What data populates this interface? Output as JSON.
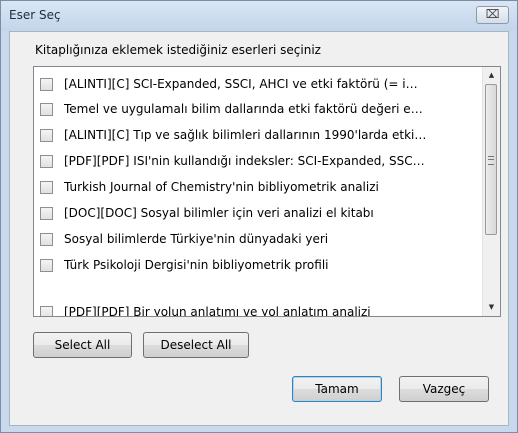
{
  "window": {
    "title": "Eser Seç",
    "close_label": "⌧"
  },
  "prompt": "Kitaplığınıza eklemek istediğiniz eserleri seçiniz",
  "items": [
    {
      "label": "[ALINTI][C] SCI-Expanded, SSCI, AHCI ve etki faktörü (= i…",
      "checked": false
    },
    {
      "label": "Temel ve uygulamalı bilim dallarında etki faktörü değeri e…",
      "checked": false
    },
    {
      "label": "[ALINTI][C] Tıp ve sağlık bilimleri dallarının 1990'larda etki…",
      "checked": false
    },
    {
      "label": "[PDF][PDF] ISI'nin kullandığı indeksler: SCI-Expanded, SSC…",
      "checked": false
    },
    {
      "label": "Turkish Journal of Chemistry'nin bibliyometrik analizi",
      "checked": false
    },
    {
      "label": "[DOC][DOC] Sosyal bilimler için veri analizi el kitabı",
      "checked": false
    },
    {
      "label": "Sosyal bilimlerde Türkiye'nin dünyadaki yeri",
      "checked": false
    },
    {
      "label": "Türk Psikoloji Dergisi'nin bibliyometrik profili",
      "checked": false
    },
    {
      "label": "[PDF][PDF] Bir yolun anlatımı ve yol anlatım analizi",
      "checked": false
    }
  ],
  "scrollbar": {
    "up_glyph": "▲",
    "down_glyph": "▼"
  },
  "buttons": {
    "select_all": "Select All",
    "deselect_all": "Deselect All",
    "ok": "Tamam",
    "cancel": "Vazgeç"
  }
}
